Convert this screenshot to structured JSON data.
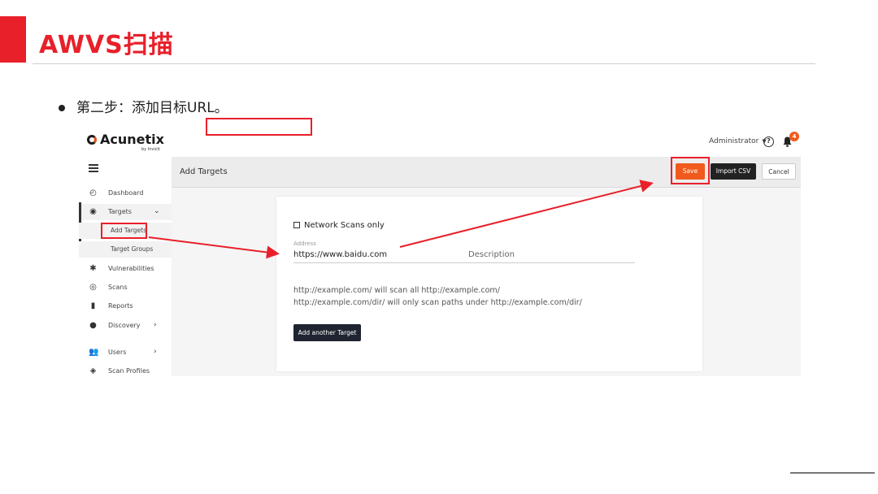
{
  "slide": {
    "title": "AWVS扫描",
    "bullet": "第二步：添加目标URL。",
    "accent_color": "#e8202a"
  },
  "app": {
    "logo": "Acunetix",
    "logo_sub": "by Invicti",
    "user": "Administrator",
    "notification_count": "4",
    "page_title": "Add Targets",
    "buttons": {
      "save": "Save",
      "import_csv": "Import CSV",
      "cancel": "Cancel",
      "add_another": "Add another Target"
    },
    "sidebar": {
      "dashboard": "Dashboard",
      "targets": "Targets",
      "add_targets": "Add Targets",
      "target_groups": "Target Groups",
      "vulnerabilities": "Vulnerabilities",
      "scans": "Scans",
      "reports": "Reports",
      "discovery": "Discovery",
      "users": "Users",
      "scan_profiles": "Scan Profiles"
    },
    "form": {
      "network_scans_only": "Network Scans only",
      "address_label": "Address",
      "address_value": "https://www.baidu.com",
      "description_placeholder": "Description",
      "help_line1": "http://example.com/ will scan all http://example.com/",
      "help_line2": "http://example.com/dir/ will only scan paths under http://example.com/dir/"
    },
    "colors": {
      "save": "#f05a1c",
      "dark_button": "#1f2430",
      "highlight": "#e8202a"
    }
  }
}
